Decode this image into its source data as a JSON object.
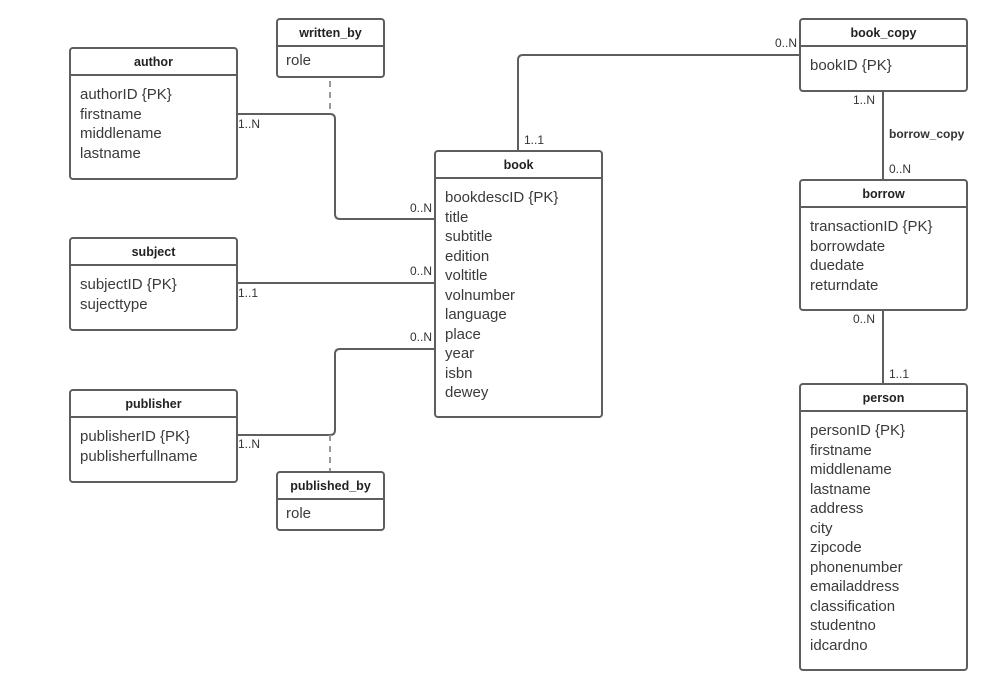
{
  "diagram": {
    "type": "entity-relationship",
    "entities": {
      "author": {
        "name": "author",
        "attributes": [
          "authorID {PK}",
          "firstname",
          "middlename",
          "lastname"
        ]
      },
      "subject": {
        "name": "subject",
        "attributes": [
          "subjectID {PK}",
          "sujecttype"
        ]
      },
      "publisher": {
        "name": "publisher",
        "attributes": [
          "publisherID {PK}",
          "publisherfullname"
        ]
      },
      "book": {
        "name": "book",
        "attributes": [
          "bookdescID {PK}",
          "title",
          "subtitle",
          "edition",
          "voltitle",
          "volnumber",
          "language",
          "place",
          "year",
          "isbn",
          "dewey"
        ]
      },
      "book_copy": {
        "name": "book_copy",
        "attributes": [
          "bookID {PK}"
        ]
      },
      "borrow": {
        "name": "borrow",
        "attributes": [
          "transactionID {PK}",
          "borrowdate",
          "duedate",
          "returndate"
        ]
      },
      "person": {
        "name": "person",
        "attributes": [
          "personID {PK}",
          "firstname",
          "middlename",
          "lastname",
          "address",
          "city",
          "zipcode",
          "phonenumber",
          "emailaddress",
          "classification",
          "studentno",
          "idcardno"
        ]
      }
    },
    "association_classes": {
      "written_by": {
        "name": "written_by",
        "attributes": [
          "role"
        ]
      },
      "published_by": {
        "name": "published_by",
        "attributes": [
          "role"
        ]
      }
    },
    "relationships": {
      "author_book": {
        "from": "author",
        "to": "book",
        "association": "written_by",
        "from_card": "1..N",
        "to_card": "0..N"
      },
      "subject_book": {
        "from": "subject",
        "to": "book",
        "from_card": "1..1",
        "to_card": "0..N"
      },
      "publisher_book": {
        "from": "publisher",
        "to": "book",
        "association": "published_by",
        "from_card": "1..N",
        "to_card": "0..N"
      },
      "book_bookcopy": {
        "from": "book",
        "to": "book_copy",
        "from_card": "1..1",
        "to_card": "0..N"
      },
      "bookcopy_borrow": {
        "from": "book_copy",
        "to": "borrow",
        "label": "borrow_copy",
        "from_card": "1..N",
        "to_card": "0..N"
      },
      "borrow_person": {
        "from": "borrow",
        "to": "person",
        "from_card": "0..N",
        "to_card": "1..1"
      }
    }
  }
}
